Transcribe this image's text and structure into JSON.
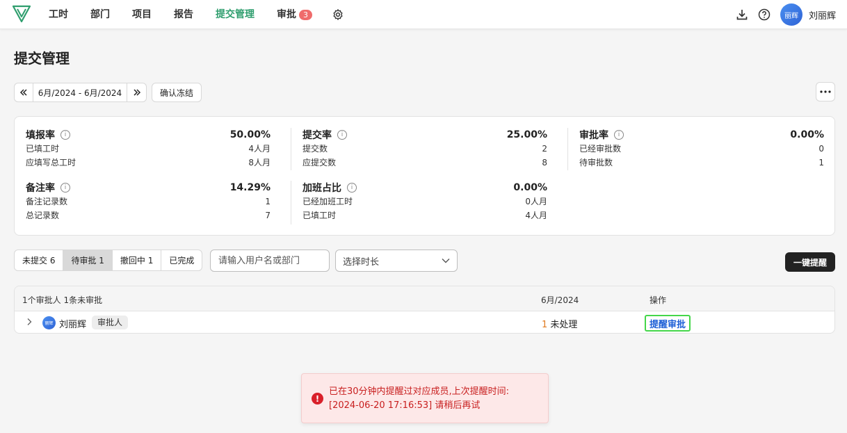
{
  "nav": {
    "items": [
      {
        "label": "工时"
      },
      {
        "label": "部门"
      },
      {
        "label": "项目"
      },
      {
        "label": "报告"
      },
      {
        "label": "提交管理"
      },
      {
        "label": "审批",
        "badge": "3"
      }
    ],
    "active_index": 4,
    "user_name": "刘丽辉",
    "avatar_text": "丽辉",
    "accent_color": "#2f9e6e"
  },
  "page": {
    "title": "提交管理"
  },
  "datebar": {
    "range": "6月/2024 - 6月/2024",
    "confirm_label": "确认冻结"
  },
  "stats": [
    {
      "name": "填报率",
      "pct": "50.00%",
      "rows": [
        [
          "已填工时",
          "4人月"
        ],
        [
          "应填写总工时",
          "8人月"
        ]
      ]
    },
    {
      "name": "提交率",
      "pct": "25.00%",
      "rows": [
        [
          "提交数",
          "2"
        ],
        [
          "应提交数",
          "8"
        ]
      ]
    },
    {
      "name": "审批率",
      "pct": "0.00%",
      "rows": [
        [
          "已经审批数",
          "0"
        ],
        [
          "待审批数",
          "1"
        ]
      ]
    },
    {
      "name": "备注率",
      "pct": "14.29%",
      "rows": [
        [
          "备注记录数",
          "1"
        ],
        [
          "总记录数",
          "7"
        ]
      ]
    },
    {
      "name": "加班占比",
      "pct": "0.00%",
      "rows": [
        [
          "已经加班工时",
          "0人月"
        ],
        [
          "已填工时",
          "4人月"
        ]
      ]
    }
  ],
  "filters": {
    "tabs": [
      "未提交 6",
      "待审批 1",
      "撤回中 1",
      "已完成"
    ],
    "active_tab": 1,
    "search_placeholder": "请输入用户名或部门",
    "duration_placeholder": "选择时长",
    "remind_all_label": "一键提醒"
  },
  "table": {
    "summary": "1个审批人 1条未审批",
    "period_header": "6月/2024",
    "action_header": "操作",
    "rows": [
      {
        "avatar_text": "丽辉",
        "name": "刘丽辉",
        "role": "审批人",
        "pending_count": "1",
        "pending_label": "未处理",
        "action_label": "提醒审批"
      }
    ]
  },
  "toast": {
    "line1": "已在30分钟内提醒过对应成员,上次提醒时间:",
    "line2": "[2024-06-20 17:16:53] 请稍后再试",
    "icon": "!"
  }
}
